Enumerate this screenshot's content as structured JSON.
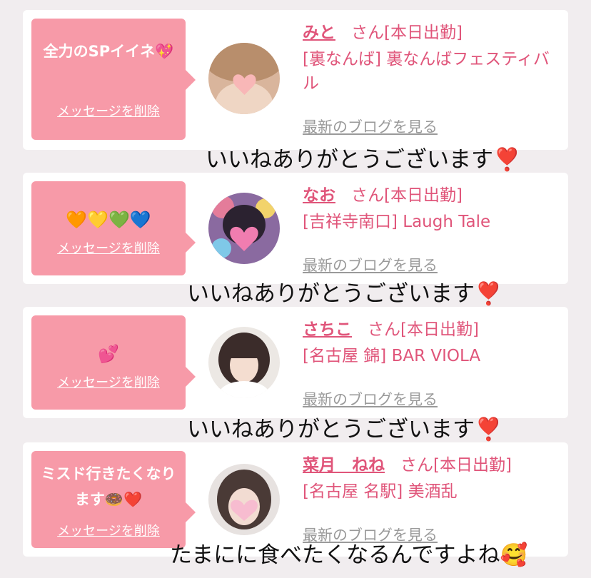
{
  "colors": {
    "page_bg": "#f1edef",
    "card_bg": "#ffffff",
    "bubble_bg": "#f79aa8",
    "accent_pink": "#e0557a",
    "link_gray": "#9a9a9a"
  },
  "delete_label": "メッセージを削除",
  "blog_label": "最新のブログを見る",
  "san_label": "さん[本日出勤]",
  "messages": [
    {
      "message": "全力のSPイイネ💖",
      "name": "みと",
      "shop": "[裏なんば] 裏なんばフェスティバル",
      "reply": "いいねありがとうございます❣️"
    },
    {
      "message": "🧡💛💚💙",
      "name": "なお",
      "shop": "[吉祥寺南口] Laugh Tale",
      "reply": "いいねありがとうございます❣️"
    },
    {
      "message": "💕",
      "name": "さちこ",
      "shop": "[名古屋 錦] BAR VIOLA",
      "reply": "いいねありがとうございます❣️"
    },
    {
      "message": "ミスド行きたくなります🍩❤️",
      "name": "菜月　ねね",
      "shop": "[名古屋 名駅] 美酒乱",
      "reply": "たまにに食べたくなるんですよね🥰"
    }
  ]
}
